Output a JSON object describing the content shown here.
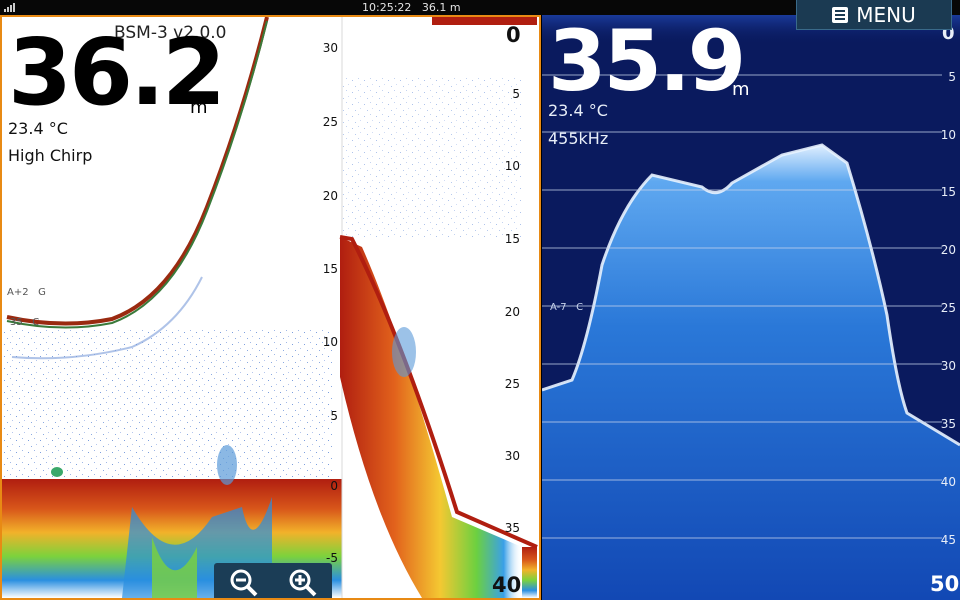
{
  "status_bar": {
    "clock": "10:25:22",
    "depth_readout": "36.1 m"
  },
  "menu": {
    "label": "MENU",
    "icon": "menu-list-icon"
  },
  "left_panel": {
    "device_label": "BSM-3 v2.0.0",
    "depth_value": "36.2",
    "depth_unit": "m",
    "temperature": "23.4 °C",
    "mode": "High Chirp",
    "gain_label": "A+2",
    "gain_letter": "G",
    "color_label": "35",
    "color_letter": "C",
    "mid_scale": [
      "30",
      "25",
      "20",
      "15",
      "10",
      "5",
      "0",
      "-5"
    ],
    "right_scale": [
      "0",
      "5",
      "10",
      "15",
      "20",
      "25",
      "30",
      "35"
    ],
    "range_end": "40",
    "zoom_out_icon": "zoom-out-icon",
    "zoom_in_icon": "zoom-in-icon"
  },
  "right_panel": {
    "depth_value": "35.9",
    "depth_unit": "m",
    "temperature": "23.4 °C",
    "frequency": "455kHz",
    "gain_label": "A-7",
    "gain_letter": "C",
    "scale": [
      "0",
      "5",
      "10",
      "15",
      "20",
      "25",
      "30",
      "35",
      "40",
      "45"
    ],
    "range_end": "50"
  },
  "colors": {
    "accent_border": "#e88a14",
    "menu_bg": "#1b3a52",
    "sonar_blue_bg": "#0a1a5e",
    "bottom_red": "#b01e10"
  }
}
